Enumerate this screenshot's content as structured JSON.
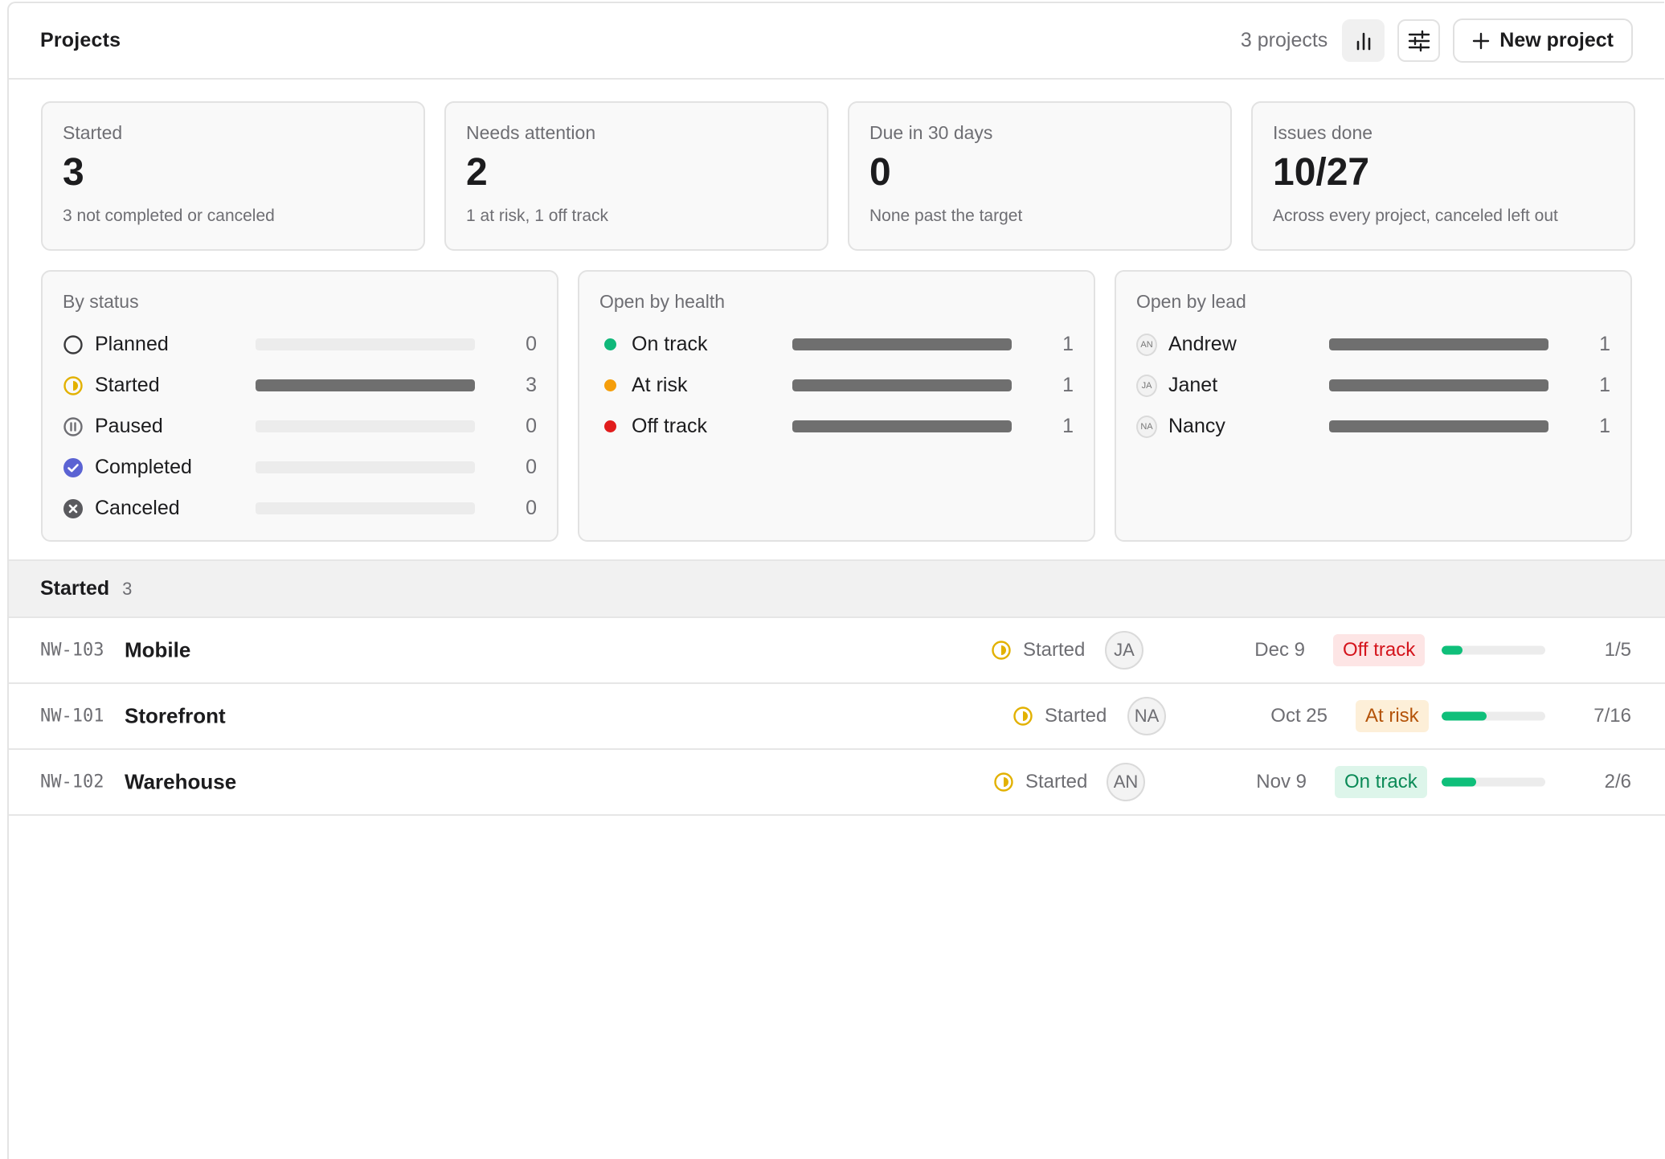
{
  "header": {
    "title": "Projects",
    "count": "3 projects",
    "new_label": "New project"
  },
  "stats": [
    {
      "label": "Started",
      "value": "3",
      "sub": "3 not completed or canceled"
    },
    {
      "label": "Needs attention",
      "value": "2",
      "sub": "1 at risk, 1 off track"
    },
    {
      "label": "Due in 30 days",
      "value": "0",
      "sub": "None past the target"
    },
    {
      "label": "Issues done",
      "value": "10/27",
      "sub": "Across every project, canceled left out"
    }
  ],
  "by_status": {
    "label": "By status",
    "items": [
      {
        "name": "Planned",
        "count": "0",
        "fraction": 0,
        "icon": "planned-icon"
      },
      {
        "name": "Started",
        "count": "3",
        "fraction": 1,
        "icon": "started-icon"
      },
      {
        "name": "Paused",
        "count": "0",
        "fraction": 0,
        "icon": "paused-icon"
      },
      {
        "name": "Completed",
        "count": "0",
        "fraction": 0,
        "icon": "completed-icon"
      },
      {
        "name": "Canceled",
        "count": "0",
        "fraction": 0,
        "icon": "canceled-icon"
      }
    ]
  },
  "by_health": {
    "label": "Open by health",
    "items": [
      {
        "name": "On track",
        "count": "1",
        "fraction": 1,
        "color": "#10b87a"
      },
      {
        "name": "At risk",
        "count": "1",
        "fraction": 1,
        "color": "#f59e0b"
      },
      {
        "name": "Off track",
        "count": "1",
        "fraction": 1,
        "color": "#e11d1d"
      }
    ]
  },
  "by_lead": {
    "label": "Open by lead",
    "items": [
      {
        "name": "Andrew",
        "initials": "AN",
        "count": "1",
        "fraction": 1
      },
      {
        "name": "Janet",
        "initials": "JA",
        "count": "1",
        "fraction": 1
      },
      {
        "name": "Nancy",
        "initials": "NA",
        "count": "1",
        "fraction": 1
      }
    ]
  },
  "group": {
    "name": "Started",
    "count": "3"
  },
  "projects": [
    {
      "id": "NW-103",
      "name": "Mobile",
      "status": "Started",
      "lead": "JA",
      "date": "Dec 9",
      "health": "Off track",
      "health_fg": "#d4141c",
      "health_bg": "#fde5e5",
      "progress": 0.2,
      "done": "1/5"
    },
    {
      "id": "NW-101",
      "name": "Storefront",
      "status": "Started",
      "lead": "NA",
      "date": "Oct 25",
      "health": "At risk",
      "health_fg": "#b45309",
      "health_bg": "#fdefd8",
      "progress": 0.4375,
      "done": "7/16"
    },
    {
      "id": "NW-102",
      "name": "Warehouse",
      "status": "Started",
      "lead": "AN",
      "date": "Nov 9",
      "health": "On track",
      "health_fg": "#0b8a57",
      "health_bg": "#ddf5ea",
      "progress": 0.333,
      "done": "2/6"
    }
  ]
}
